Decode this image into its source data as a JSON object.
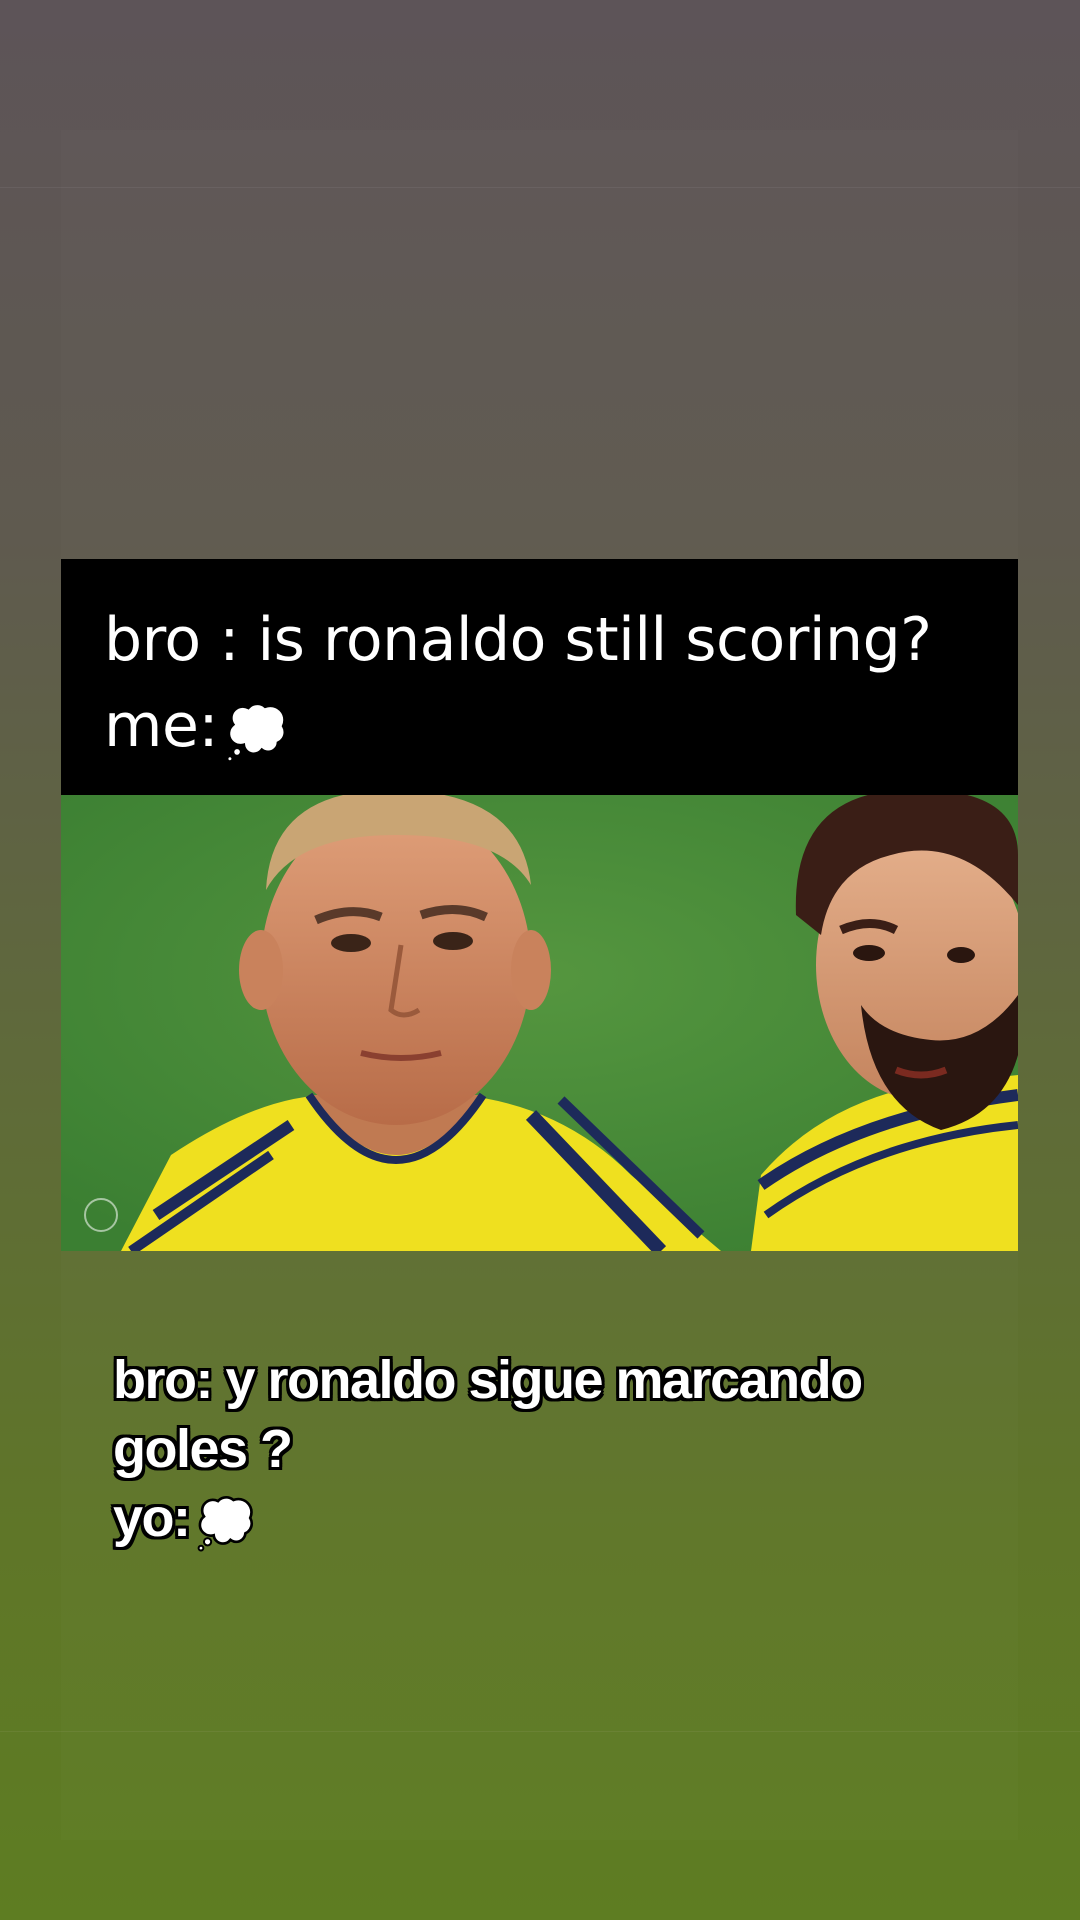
{
  "caption": {
    "line1": "bro : is ronaldo still scoring?",
    "line2_prefix": "me:",
    "thought_icon": "thought-balloon-icon"
  },
  "subtitle": {
    "line1": "bro: y ronaldo sigue marcando",
    "line2": "goles ?",
    "line3_prefix": "yo:",
    "thought_icon": "thought-balloon-icon"
  },
  "colors": {
    "caption_bg": "#000000",
    "caption_text": "#ffffff",
    "jersey_yellow": "#f2e21e",
    "jersey_stripe": "#1d2a5a",
    "pitch_green": "#3f8a36"
  }
}
